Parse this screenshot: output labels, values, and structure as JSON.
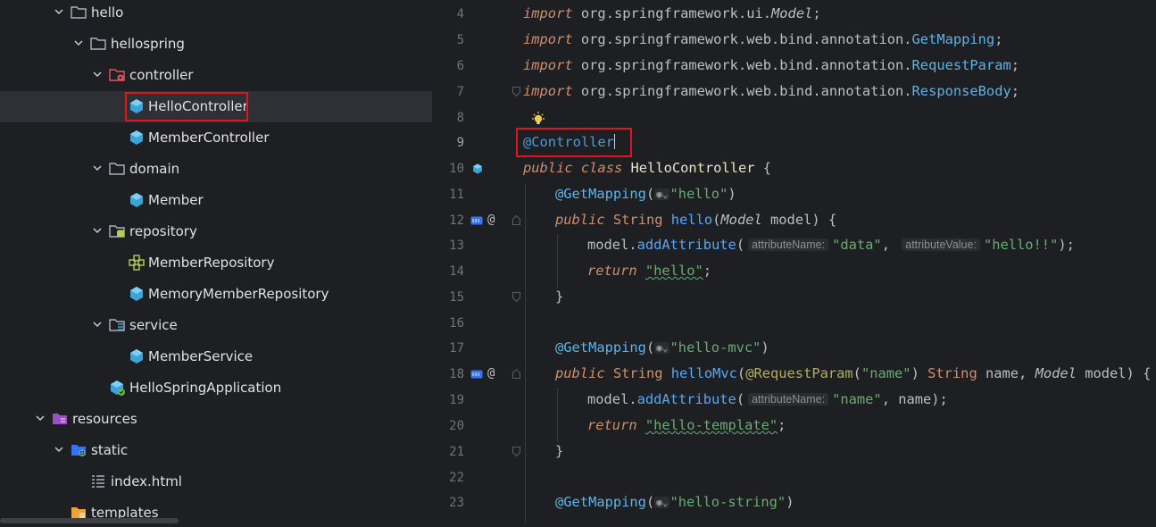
{
  "project_tree": {
    "items": [
      {
        "label": "hello",
        "icon": "folder-icon",
        "expanded": true
      },
      {
        "label": "hellospring",
        "icon": "folder-icon",
        "expanded": true
      },
      {
        "label": "controller",
        "icon": "controller-folder-icon",
        "expanded": true
      },
      {
        "label": "HelloController",
        "icon": "class-icon",
        "selected": true
      },
      {
        "label": "MemberController",
        "icon": "class-icon"
      },
      {
        "label": "domain",
        "icon": "folder-icon",
        "expanded": true
      },
      {
        "label": "Member",
        "icon": "class-icon"
      },
      {
        "label": "repository",
        "icon": "repository-folder-icon",
        "expanded": true
      },
      {
        "label": "MemberRepository",
        "icon": "interface-icon"
      },
      {
        "label": "MemoryMemberRepository",
        "icon": "class-icon"
      },
      {
        "label": "service",
        "icon": "service-folder-icon",
        "expanded": true
      },
      {
        "label": "MemberService",
        "icon": "class-icon"
      },
      {
        "label": "HelloSpringApplication",
        "icon": "spring-boot-app-icon"
      },
      {
        "label": "resources",
        "icon": "resources-folder-icon",
        "expanded": true
      },
      {
        "label": "static",
        "icon": "web-folder-icon",
        "expanded": true
      },
      {
        "label": "index.html",
        "icon": "html-file-icon"
      },
      {
        "label": "templates",
        "icon": "templates-folder-icon"
      }
    ]
  },
  "editor": {
    "lines": [
      {
        "num": "4"
      },
      {
        "num": "5"
      },
      {
        "num": "6"
      },
      {
        "num": "7"
      },
      {
        "num": "8"
      },
      {
        "num": "9"
      },
      {
        "num": "10"
      },
      {
        "num": "11"
      },
      {
        "num": "12"
      },
      {
        "num": "13"
      },
      {
        "num": "14"
      },
      {
        "num": "15"
      },
      {
        "num": "16"
      },
      {
        "num": "17"
      },
      {
        "num": "18"
      },
      {
        "num": "19"
      },
      {
        "num": "20"
      },
      {
        "num": "21"
      },
      {
        "num": "22"
      },
      {
        "num": "23"
      }
    ],
    "imports": {
      "kw": "import",
      "l4_pkg": "org.springframework.ui.",
      "l4_cls": "Model",
      "l4_end": ";",
      "l5_pkg": "org.springframework.web.bind.annotation.",
      "l5_cls": "GetMapping",
      "l5_end": ";",
      "l6_pkg": "org.springframework.web.bind.annotation.",
      "l6_cls": "RequestParam",
      "l6_end": ";",
      "l7_pkg": "org.springframework.web.bind.annotation.",
      "l7_cls": "ResponseBody",
      "l7_end": ";"
    },
    "l9": "@Controller",
    "l10": {
      "kw1": "public",
      "kw2": "class",
      "name": "HelloController",
      "rest": " {"
    },
    "l11": {
      "ann": "@GetMapping",
      "open": "(",
      "str": "\"hello\"",
      "close": ")"
    },
    "l12": {
      "kw": "public",
      "type": "String",
      "fn": "hello",
      "p1": "(",
      "ptype": "Model",
      "rest": " model) {"
    },
    "l13": {
      "obj": "model.",
      "fn": "addAttribute",
      "open": "(",
      "hint1": "attributeName:",
      "s1": "\"data\"",
      "comma": ",",
      "hint2": "attributeValue:",
      "s2": "\"hello!!\"",
      "end": ");"
    },
    "l14": {
      "kw": "return",
      "s": "\"hello\"",
      "end": ";"
    },
    "l15": "}",
    "l17": {
      "ann": "@GetMapping",
      "open": "(",
      "str": "\"hello-mvc\"",
      "close": ")"
    },
    "l18": {
      "kw": "public",
      "type": "String",
      "fn": "helloMvc",
      "p1": "(",
      "ann": "@RequestParam",
      "p2": "(",
      "s": "\"name\"",
      "p3": ") ",
      "type2": "String",
      "p4": " name, ",
      "ptype": "Model",
      "rest": " model) {"
    },
    "l19": {
      "obj": "model.",
      "fn": "addAttribute",
      "open": "(",
      "hint1": "attributeName:",
      "s1": "\"name\"",
      "end": ", name);"
    },
    "l20": {
      "kw": "return",
      "s": "\"hello-template\"",
      "end": ";"
    },
    "l21": "}",
    "l23": {
      "ann": "@GetMapping",
      "open": "(",
      "str": "\"hello-string\"",
      "close": ")"
    },
    "globe_chevron": "⌄"
  },
  "colors": {
    "highlight_box": "#e0161f",
    "background": "#1e1f22"
  }
}
